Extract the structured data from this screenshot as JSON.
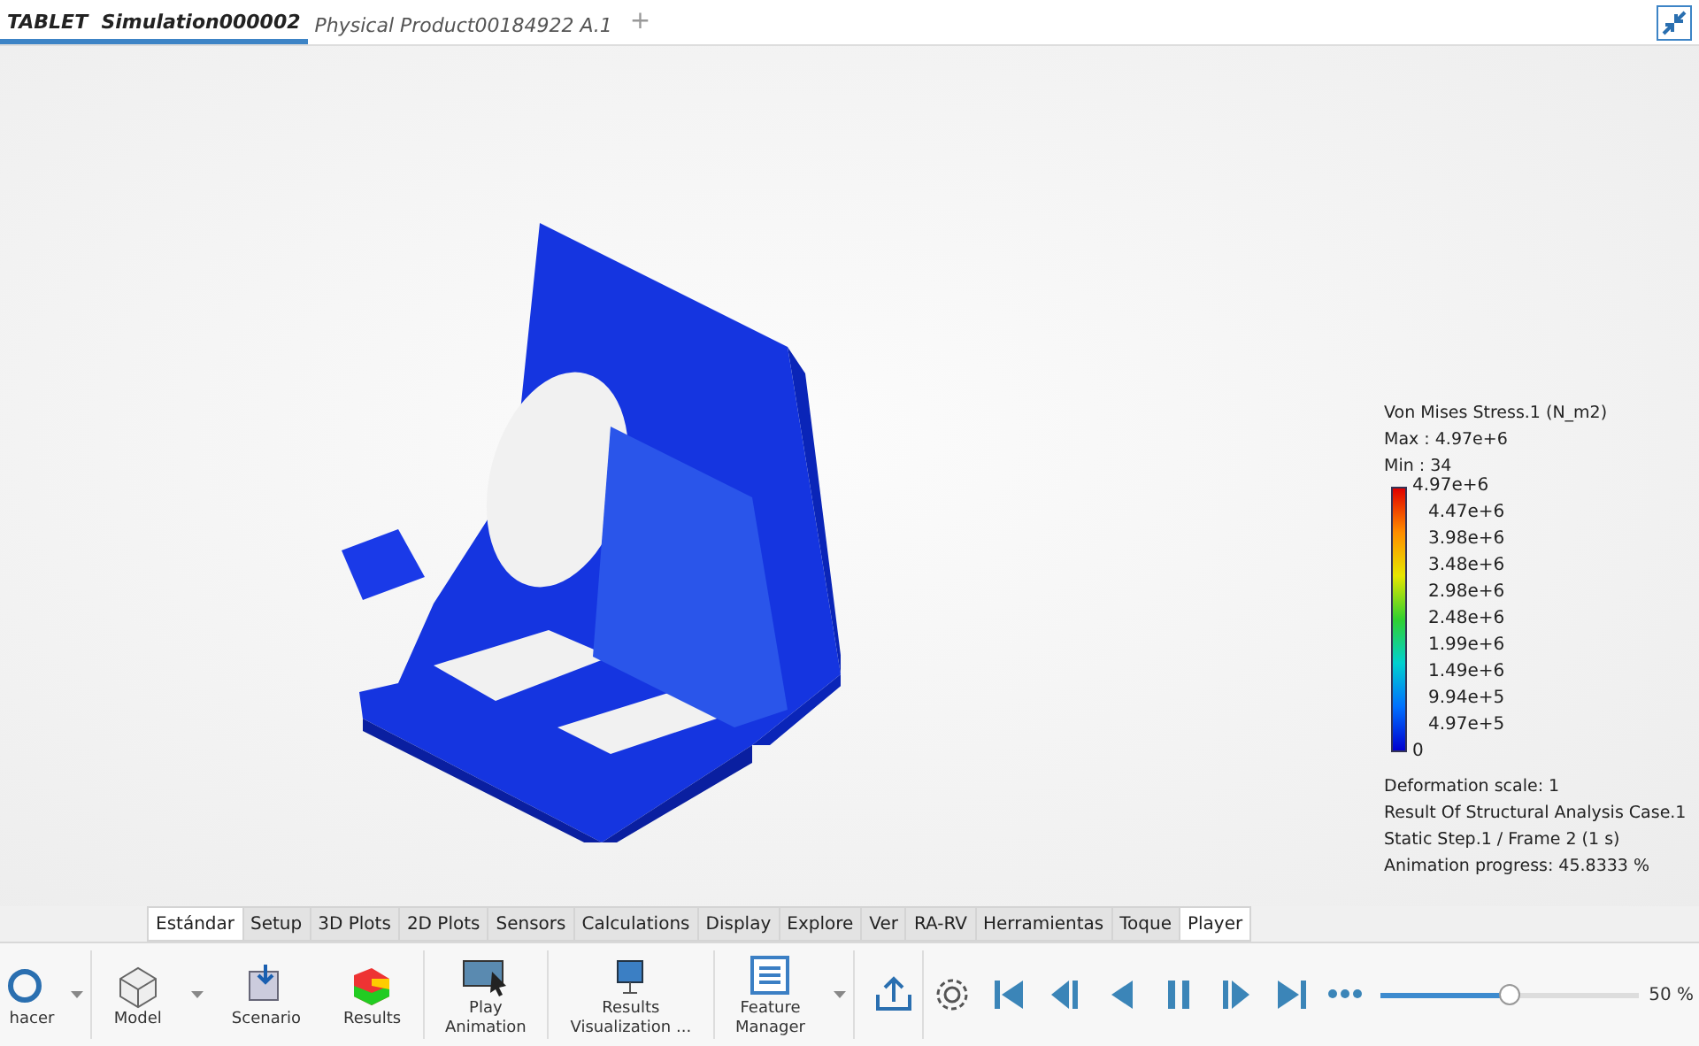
{
  "doc_tabs": [
    {
      "label": "TABLET  Simulation000002",
      "selected": true
    },
    {
      "label": "Physical Product00184922 A.1",
      "selected": false
    }
  ],
  "add_tab": "+",
  "legend": {
    "title": "Von Mises Stress.1 (N_m2)",
    "max": "Max : 4.97e+6",
    "min": "Min : 34",
    "ticks": [
      "4.97e+6",
      "4.47e+6",
      "3.98e+6",
      "3.48e+6",
      "2.98e+6",
      "2.48e+6",
      "1.99e+6",
      "1.49e+6",
      "9.94e+5",
      "4.97e+5",
      "0"
    ],
    "info": [
      "Deformation scale: 1",
      "Result Of Structural Analysis Case.1",
      "Static Step.1 / Frame 2 (1 s)",
      "Animation progress: 45.8333 %"
    ]
  },
  "ribbon_tabs": [
    {
      "label": "Estándar",
      "selected": true
    },
    {
      "label": "Setup",
      "selected": false
    },
    {
      "label": "3D Plots",
      "selected": false
    },
    {
      "label": "2D Plots",
      "selected": false
    },
    {
      "label": "Sensors",
      "selected": false
    },
    {
      "label": "Calculations",
      "selected": false
    },
    {
      "label": "Display",
      "selected": false
    },
    {
      "label": "Explore",
      "selected": false
    },
    {
      "label": "Ver",
      "selected": false
    },
    {
      "label": "RA-RV",
      "selected": false
    },
    {
      "label": "Herramientas",
      "selected": false
    },
    {
      "label": "Toque",
      "selected": false
    },
    {
      "label": "Player",
      "selected": true
    }
  ],
  "commands": [
    {
      "kind": "undo",
      "label": "hacer",
      "dropdown": true
    },
    {
      "kind": "model",
      "label": "Model",
      "dropdown": true
    },
    {
      "kind": "scenario",
      "label": "Scenario",
      "dropdown": false
    },
    {
      "kind": "results",
      "label": "Results",
      "dropdown": false
    },
    {
      "kind": "play",
      "label": "Play\nAnimation",
      "dropdown": false
    },
    {
      "kind": "visual",
      "label": "Results\nVisualization ...",
      "dropdown": false
    },
    {
      "kind": "feature",
      "label": "Feature\nManager",
      "dropdown": true
    }
  ],
  "player": {
    "level": 0.5,
    "reading": "50 %"
  }
}
